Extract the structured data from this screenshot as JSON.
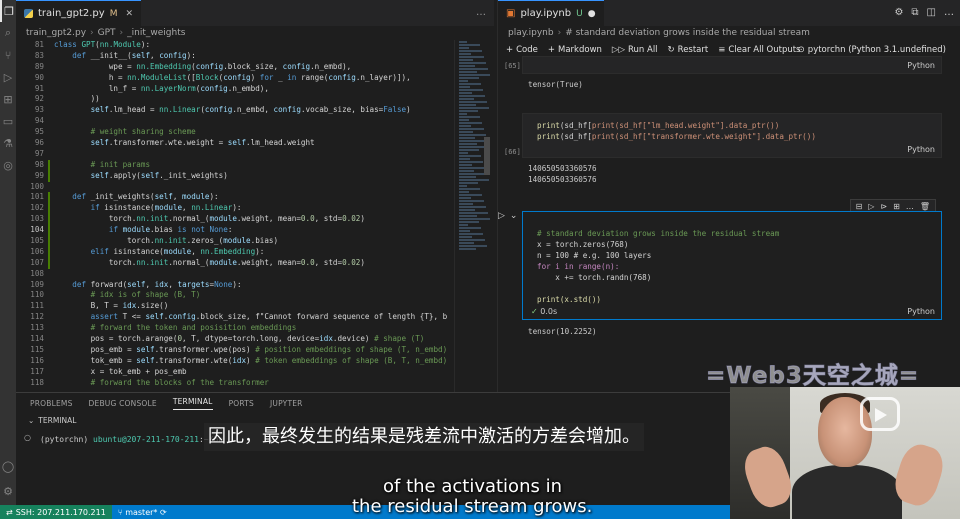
{
  "left_editor": {
    "tab": {
      "filename": "train_gpt2.py",
      "status": "M"
    },
    "breadcrumb": [
      "train_gpt2.py",
      "GPT",
      "_init_weights"
    ],
    "lines": [
      {
        "n": "81",
        "t": "class GPT(nn.Module):"
      },
      {
        "n": "83",
        "t": "    def __init__(self, config):"
      },
      {
        "n": "89",
        "t": "            wpe = nn.Embedding(config.block_size, config.n_embd),"
      },
      {
        "n": "90",
        "t": "            h = nn.ModuleList([Block(config) for _ in range(config.n_layer)]),"
      },
      {
        "n": "91",
        "t": "            ln_f = nn.LayerNorm(config.n_embd),"
      },
      {
        "n": "92",
        "t": "        ))"
      },
      {
        "n": "93",
        "t": "        self.lm_head = nn.Linear(config.n_embd, config.vocab_size, bias=False)"
      },
      {
        "n": "94",
        "t": ""
      },
      {
        "n": "95",
        "t": "        # weight sharing scheme"
      },
      {
        "n": "96",
        "t": "        self.transformer.wte.weight = self.lm_head.weight"
      },
      {
        "n": "97",
        "t": ""
      },
      {
        "n": "98",
        "t": "        # init params"
      },
      {
        "n": "99",
        "t": "        self.apply(self._init_weights)"
      },
      {
        "n": "100",
        "t": ""
      },
      {
        "n": "101",
        "t": "    def _init_weights(self, module):"
      },
      {
        "n": "102",
        "t": "        if isinstance(module, nn.Linear):"
      },
      {
        "n": "103",
        "t": "            torch.nn.init.normal_(module.weight, mean=0.0, std=0.02)"
      },
      {
        "n": "104",
        "t": "            if module.bias is not None:"
      },
      {
        "n": "105",
        "t": "                torch.nn.init.zeros_(module.bias)"
      },
      {
        "n": "106",
        "t": "        elif isinstance(module, nn.Embedding):"
      },
      {
        "n": "107",
        "t": "            torch.nn.init.normal_(module.weight, mean=0.0, std=0.02)"
      },
      {
        "n": "108",
        "t": ""
      },
      {
        "n": "109",
        "t": "    def forward(self, idx, targets=None):"
      },
      {
        "n": "110",
        "t": "        # idx is of shape (B, T)"
      },
      {
        "n": "111",
        "t": "        B, T = idx.size()"
      },
      {
        "n": "112",
        "t": "        assert T <= self.config.block_size, f\"Cannot forward sequence of length {T}, b"
      },
      {
        "n": "113",
        "t": "        # forward the token and posisition embeddings"
      },
      {
        "n": "114",
        "t": "        pos = torch.arange(0, T, dtype=torch.long, device=idx.device) # shape (T)"
      },
      {
        "n": "115",
        "t": "        pos_emb = self.transformer.wpe(pos) # position embeddings of shape (T, n_embd)"
      },
      {
        "n": "116",
        "t": "        tok_emb = self.transformer.wte(idx) # token embeddings of shape (B, T, n_embd)"
      },
      {
        "n": "117",
        "t": "        x = tok_emb + pos_emb"
      },
      {
        "n": "118",
        "t": "        # forward the blocks of the transformer"
      }
    ]
  },
  "notebook": {
    "tab": {
      "filename": "play.ipynb",
      "status": "U"
    },
    "breadcrumb": [
      "play.ipynb",
      "# standard deviation grows inside the residual stream"
    ],
    "toolbar": {
      "code": "Code",
      "markdown": "Markdown",
      "run_all": "Run All",
      "restart": "Restart",
      "clear_all": "Clear All Outputs",
      "kernel": "pytorchn (Python 3.1.undefined)"
    },
    "cell1": {
      "exec": "[65]",
      "lang": "Python",
      "output": "tensor(True)"
    },
    "cell2": {
      "exec": "[66]",
      "lines": [
        "print(sd_hf[\"lm_head.weight\"].data_ptr())",
        "print(sd_hf[\"transformer.wte.weight\"].data_ptr())"
      ],
      "lang": "Python",
      "output": [
        "140650503360576",
        "140650503360576"
      ]
    },
    "cell3": {
      "lines": [
        "# standard deviation grows inside the residual stream",
        "x = torch.zeros(768)",
        "n = 100 # e.g. 100 layers",
        "for i in range(n):",
        "    x += torch.randn(768)",
        "",
        "print(x.std())"
      ],
      "status": "0.0s",
      "lang": "Python",
      "output": "tensor(10.2252)"
    }
  },
  "panel": {
    "tabs": [
      "PROBLEMS",
      "DEBUG CONSOLE",
      "TERMINAL",
      "PORTS",
      "JUPYTER"
    ],
    "active_tab": "TERMINAL",
    "section": "TERMINAL",
    "prompt_env": "(pytorchn)",
    "prompt_user": "ubuntu@207-211-170-211",
    "prompt_path": ":~/bu"
  },
  "statusbar": {
    "remote": "SSH: 207.211.170.211",
    "branch": "master*"
  },
  "overlay": {
    "watermark": "=Web3天空之城=",
    "subtitle_cn": "因此，最终发生的结果是残差流中激活的方差会增加。",
    "subtitle_en_1": "of the activations in",
    "subtitle_en_2": "the residual stream grows."
  },
  "colors": {
    "accent": "#007acc",
    "remote": "#16825d",
    "modified": "#e2c08d"
  }
}
